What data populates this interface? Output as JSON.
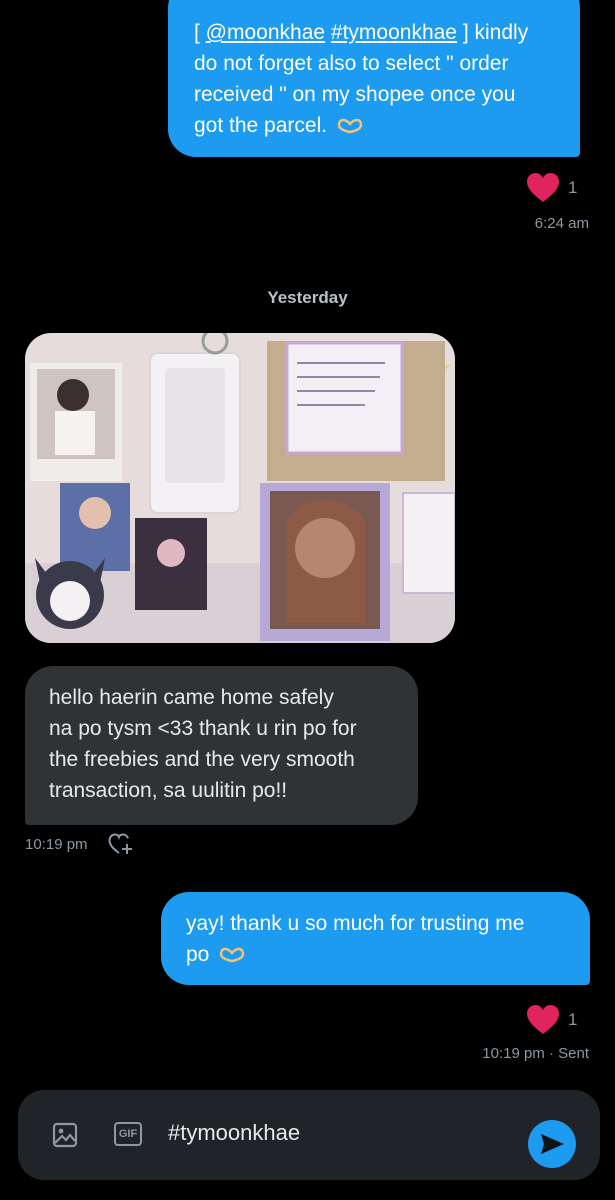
{
  "messages": {
    "m1": {
      "mention": "@moonkhae",
      "hashtag": "#tymoonkhae",
      "line1_end": "] kindly",
      "line2": "do not forget also to select \" order",
      "line3": "received \" on my shopee once you",
      "line4": "got the parcel.",
      "likes": "1",
      "time": "6:24 am"
    },
    "divider": "Yesterday",
    "m2": {
      "line1": "hello haerin came home safely",
      "line2": "na po tysm <33 thank u rin po for",
      "line3": "the freebies and the very smooth",
      "line4": "transaction, sa uulitin po!!",
      "time": "10:19 pm"
    },
    "m3": {
      "line1": "yay! thank u so much for trusting me",
      "line2": "po",
      "likes": "1",
      "time": "10:19 pm · Sent"
    }
  },
  "composer": {
    "text": "#tymoonkhae",
    "gif_label": "GIF"
  },
  "colors": {
    "outgoing_bubble": "#1d9bf0",
    "incoming_bubble": "#2f3336",
    "heart": "#e0245e"
  }
}
